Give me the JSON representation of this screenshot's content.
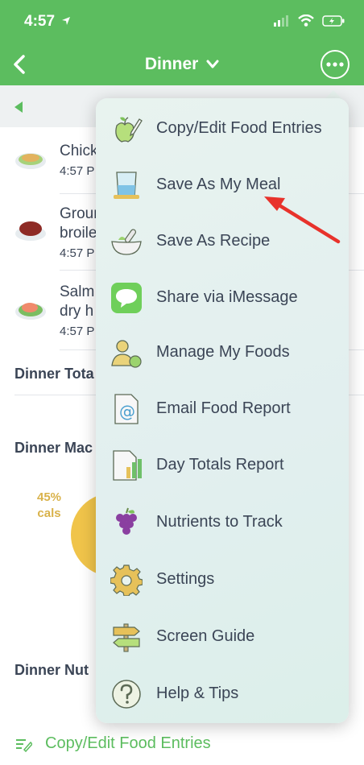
{
  "status": {
    "time": "4:57"
  },
  "nav": {
    "title": "Dinner"
  },
  "foods": [
    {
      "name": "Chick",
      "time": "4:57 P"
    },
    {
      "name": "Groun\nbroile",
      "time": "4:57 P"
    },
    {
      "name": "Salm\ndry h",
      "time": "4:57 P"
    }
  ],
  "sections": {
    "totals": "Dinner Tota",
    "macros": "Dinner Mac",
    "nutrients": "Dinner Nut"
  },
  "macro_chart": {
    "pct": "45%",
    "unit": "cals"
  },
  "bottom": {
    "label": "Copy/Edit Food Entries"
  },
  "menu": {
    "items": [
      {
        "label": "Copy/Edit Food Entries",
        "icon": "apple-pencil-icon"
      },
      {
        "label": "Save As My Meal",
        "icon": "glass-icon"
      },
      {
        "label": "Save As Recipe",
        "icon": "mortar-bowl-icon"
      },
      {
        "label": "Share via iMessage",
        "icon": "message-bubble-icon"
      },
      {
        "label": "Manage My Foods",
        "icon": "person-apple-icon"
      },
      {
        "label": "Email Food Report",
        "icon": "email-document-icon"
      },
      {
        "label": "Day Totals Report",
        "icon": "bar-report-icon"
      },
      {
        "label": "Nutrients to Track",
        "icon": "grapes-icon"
      },
      {
        "label": "Settings",
        "icon": "gear-icon"
      },
      {
        "label": "Screen Guide",
        "icon": "signpost-icon"
      },
      {
        "label": "Help & Tips",
        "icon": "question-icon"
      }
    ]
  },
  "colors": {
    "brand": "#5cbd5f",
    "annotation": "#e8322b"
  }
}
